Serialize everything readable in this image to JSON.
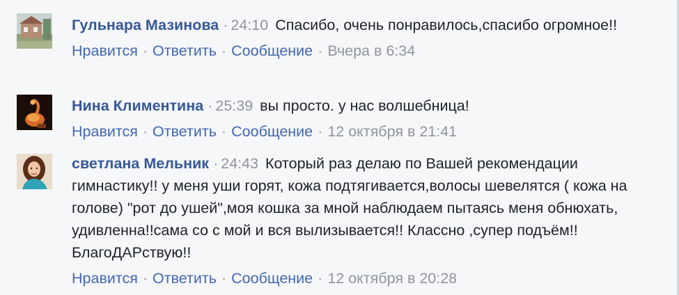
{
  "comments": [
    {
      "author": "Гульнара Мазинова",
      "elapsed": "24:10",
      "text": "Спасибо, очень понравилось,спасибо огромное!!",
      "avatar_icon": "photo-house-avatar",
      "actions": {
        "like": "Нравится",
        "reply": "Ответить",
        "message": "Сообщение"
      },
      "time": "Вчера в 6:34"
    },
    {
      "author": "Нина Климентина",
      "elapsed": "25:39",
      "text": "вы просто. у нас волшебница!",
      "avatar_icon": "photo-flamingo-avatar",
      "actions": {
        "like": "Нравится",
        "reply": "Ответить",
        "message": "Сообщение"
      },
      "time": "12 октября в 21:41"
    },
    {
      "author": "светлана Мельник",
      "elapsed": "24:43",
      "text": "Который раз делаю по Вашей рекомендации гимнастику!! у меня уши горят, кожа подтягивается,волосы шевелятся ( кожа на голове) \"рот до ушей\",моя кошка за мной наблюдаем пытаясь меня обнюхать, удивленна!!сама со с мой и вся вылизывается!! Классно ,супер подъём!! БлагоДАРствую!!",
      "avatar_icon": "photo-woman-avatar",
      "actions": {
        "like": "Нравится",
        "reply": "Ответить",
        "message": "Сообщение"
      },
      "time": "12 октября в 20:28"
    }
  ],
  "colors": {
    "author": "#365899",
    "link": "#4267b2",
    "meta": "#90949c",
    "text": "#1d2129",
    "background": "#f6f7f9"
  }
}
